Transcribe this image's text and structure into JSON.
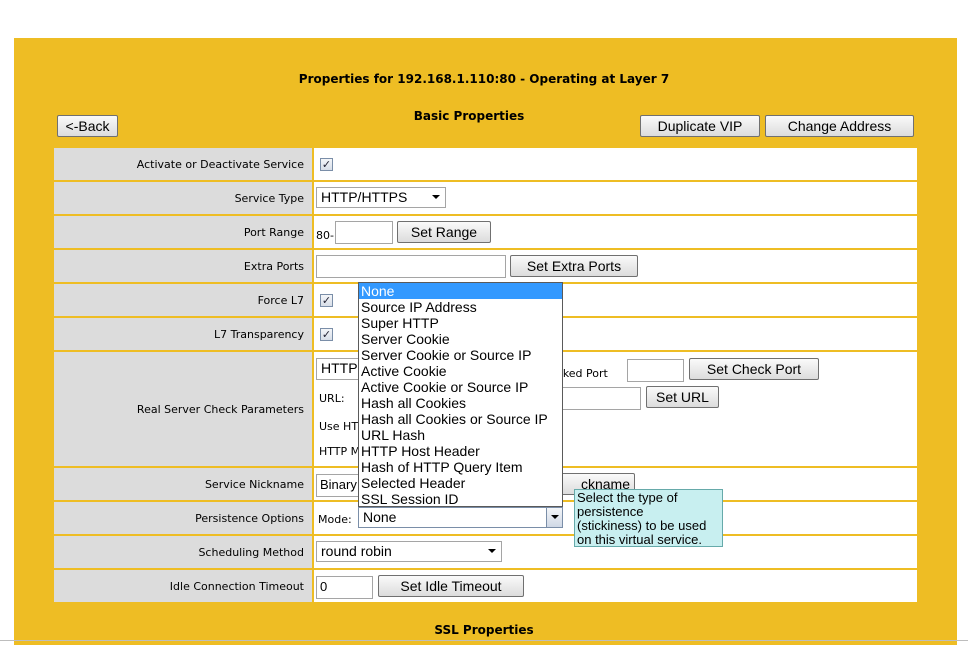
{
  "header": {
    "title": "Properties for 192.168.1.110:80 - Operating at Layer 7",
    "section_basic": "Basic Properties",
    "section_ssl": "SSL Properties"
  },
  "toolbar": {
    "back_label": "<-Back",
    "duplicate_label": "Duplicate VIP",
    "change_address_label": "Change Address"
  },
  "rows": {
    "activate": {
      "label": "Activate or Deactivate Service",
      "checked": "✓"
    },
    "service_type": {
      "label": "Service Type",
      "value": "HTTP/HTTPS"
    },
    "port_range": {
      "label": "Port Range",
      "prefix": "80-",
      "value": "",
      "button": "Set Range"
    },
    "extra_ports": {
      "label": "Extra Ports",
      "value": "",
      "button": "Set Extra Ports"
    },
    "force_l7": {
      "label": "Force L7",
      "checked": "✓"
    },
    "l7_transparency": {
      "label": "L7 Transparency",
      "checked": "✓"
    },
    "real_server_check": {
      "label": "Real Server Check Parameters",
      "check_select_partial": "HTTP",
      "checked_port_partial": "ecked Port",
      "checked_port_value": "",
      "check_port_button": "Set Check Port",
      "url_label": "URL:",
      "url_value": "",
      "url_button": "Set URL",
      "use_http_partial": "Use HT",
      "http_method_partial": "HTTP M"
    },
    "service_nickname": {
      "label": "Service Nickname",
      "value_partial": "Binary",
      "button_partial": "ckname"
    },
    "persistence": {
      "label": "Persistence Options",
      "mode_label": "Mode:",
      "mode_value": "None"
    },
    "scheduling": {
      "label": "Scheduling Method",
      "value": "round robin"
    },
    "idle_timeout": {
      "label": "Idle Connection Timeout",
      "value": "0",
      "button": "Set Idle Timeout"
    }
  },
  "persistence_options": [
    "None",
    "Source IP Address",
    "Super HTTP",
    "Server Cookie",
    "Server Cookie or Source IP",
    "Active Cookie",
    "Active Cookie or Source IP",
    "Hash all Cookies",
    "Hash all Cookies or Source IP",
    "URL Hash",
    "HTTP Host Header",
    "Hash of HTTP Query Item",
    "Selected Header",
    "SSL Session ID"
  ],
  "tooltip": {
    "line1": "Select the type of",
    "line2": "persistence",
    "line3": "(stickiness) to be used",
    "line4": "on this virtual service."
  },
  "colors": {
    "panel": "#eebd24",
    "label_bg": "#dcdcdc",
    "highlight": "#3399ff",
    "tooltip_bg": "#c8eff0"
  }
}
